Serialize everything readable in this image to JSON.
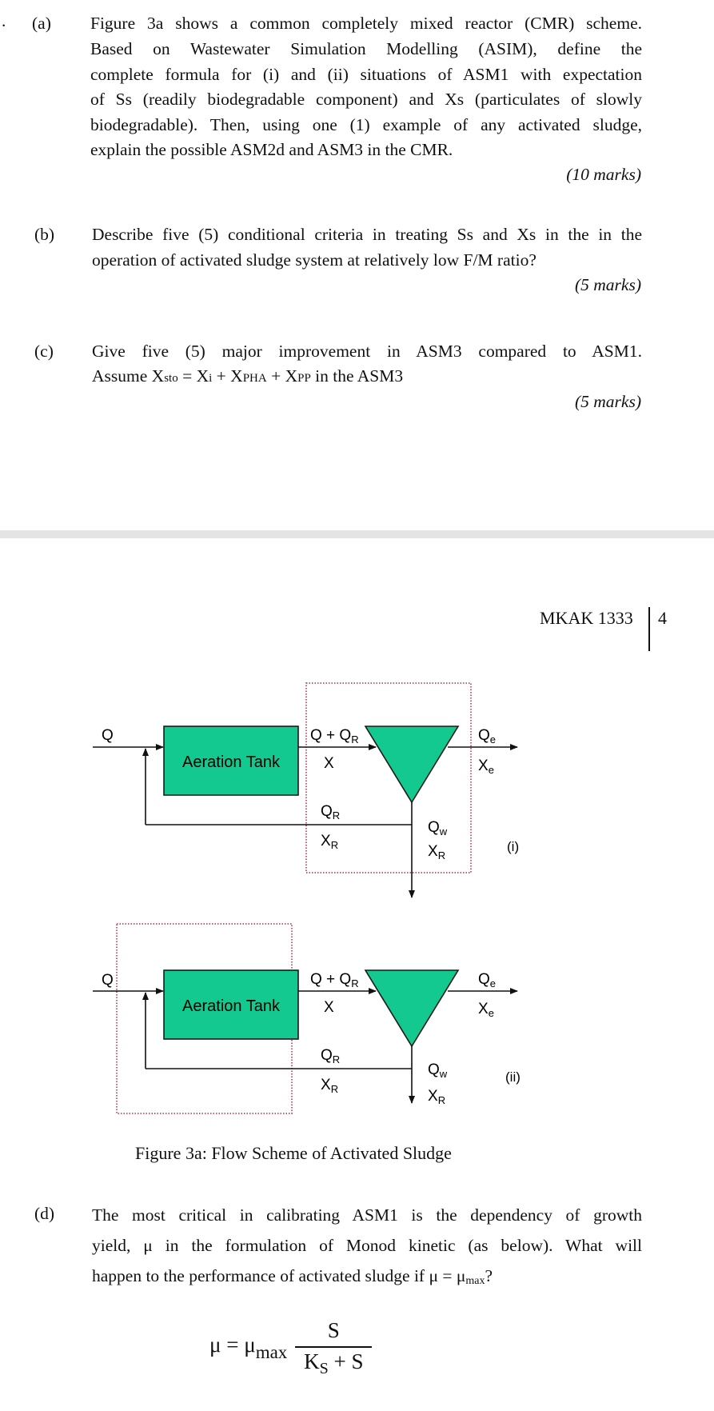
{
  "page1": {
    "bullet": ".",
    "question_a": {
      "label": "(a)",
      "lines": [
        "Figure 3a shows a common completely mixed reactor (CMR) scheme.",
        "Based on Wastewater Simulation Modelling (ASIM), define the",
        "complete formula for (i) and (ii) situations of ASM1 with expectation",
        "of Ss (readily biodegradable component) and Xs (particulates of slowly",
        "biodegradable). Then, using one (1) example of any activated sludge,",
        "explain the possible ASM2d and ASM3 in the CMR."
      ],
      "marks": "(10 marks)"
    },
    "question_b": {
      "label": "(b)",
      "lines": [
        "Describe five (5) conditional criteria in treating Ss and Xs in the in the",
        "operation of activated sludge system at relatively low F/M ratio?"
      ],
      "marks": "(5 marks)"
    },
    "question_c": {
      "label": "(c)",
      "line1": "Give five (5) major improvement in ASM3 compared to ASM1.",
      "line2": {
        "prefix": "Assume X",
        "sto": "sto",
        "eq": " = X",
        "i": "i",
        "plus1": " + X",
        "pha": "PHA",
        "plus2": " + X",
        "pp": "PP",
        "suffix": " in the ASM3"
      },
      "marks": "(5 marks)"
    }
  },
  "page2": {
    "header": {
      "course_code": "MKAK 1333",
      "page_number": "4"
    },
    "figure": {
      "colors": {
        "tank_fill": "#14c98f",
        "boundary": "#c0607a",
        "line": "#111111"
      },
      "diagrams": [
        {
          "id": "i",
          "tag": "(i)",
          "tank_label": "Aeration Tank",
          "labels": {
            "inflow": "Q",
            "mixed_flow": "Q + Q",
            "mixed_flow_sub": "R",
            "mixed_conc": "X",
            "effluent_flow": "Q",
            "effluent_flow_sub": "e",
            "effluent_conc": "X",
            "effluent_conc_sub": "e",
            "recycle_flow": "Q",
            "recycle_flow_sub": "R",
            "recycle_conc": "X",
            "recycle_conc_sub": "R",
            "waste_flow": "Q",
            "waste_flow_sub": "w",
            "waste_conc": "X",
            "waste_conc_sub": "R"
          },
          "boundary_around": "clarifier"
        },
        {
          "id": "ii",
          "tag": "(ii)",
          "tank_label": "Aeration Tank",
          "labels": {
            "inflow": "Q",
            "mixed_flow": "Q + Q",
            "mixed_flow_sub": "R",
            "mixed_conc": "X",
            "effluent_flow": "Q",
            "effluent_flow_sub": "e",
            "effluent_conc": "X",
            "effluent_conc_sub": "e",
            "recycle_flow": "Q",
            "recycle_flow_sub": "R",
            "recycle_conc": "X",
            "recycle_conc_sub": "R",
            "waste_flow": "Q",
            "waste_flow_sub": "w",
            "waste_conc": "X",
            "waste_conc_sub": "R"
          },
          "boundary_around": "aeration-tank"
        }
      ],
      "caption": "Figure 3a: Flow Scheme of Activated Sludge"
    },
    "question_d": {
      "label": "(d)",
      "line1": "The most critical in calibrating ASM1 is the dependency of growth",
      "line2": "yield, μ in the formulation of Monod kinetic (as below). What will",
      "line3_prefix": "happen to the performance of activated sludge if μ = μ",
      "line3_sub": "max",
      "line3_suffix": "?"
    },
    "formula": {
      "lhs": "μ = μ",
      "lhs_sub": "max",
      "numerator": "S",
      "denominator_k": "K",
      "denominator_k_sub": "S",
      "denominator_rest": " + S"
    }
  }
}
